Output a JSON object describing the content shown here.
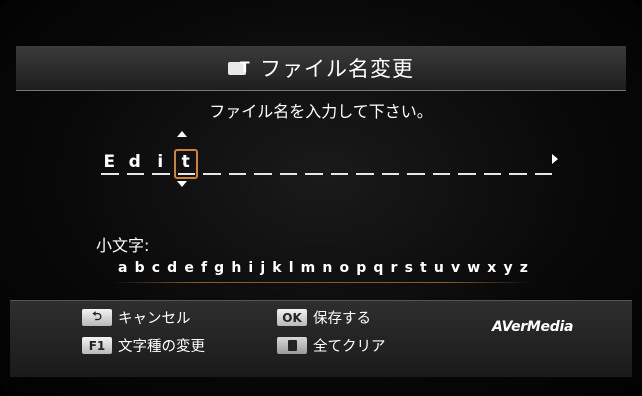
{
  "title": "ファイル名変更",
  "title_icon": "file-rename-icon",
  "prompt": "ファイル名を入力して下さい。",
  "filename": {
    "slots": [
      "E",
      "d",
      "i",
      "t",
      "",
      "",
      "",
      "",
      "",
      "",
      "",
      "",
      "",
      "",
      "",
      "",
      "",
      ""
    ],
    "cursor_index": 3
  },
  "case_label": "小文字:",
  "alphabet": [
    "a",
    "b",
    "c",
    "d",
    "e",
    "f",
    "g",
    "h",
    "i",
    "j",
    "k",
    "l",
    "m",
    "n",
    "o",
    "p",
    "q",
    "r",
    "s",
    "t",
    "u",
    "v",
    "w",
    "x",
    "y",
    "z"
  ],
  "footer": {
    "cancel": {
      "key": "⮌",
      "label": "キャンセル"
    },
    "save": {
      "key": "OK",
      "label": "保存する"
    },
    "change_type": {
      "key": "F1",
      "label": "文字種の変更"
    },
    "clear_all": {
      "key": "",
      "label": "全てクリア"
    }
  },
  "brand": "AVerMedia",
  "colors": {
    "cursor": "#d0813a",
    "background": "#000000"
  }
}
